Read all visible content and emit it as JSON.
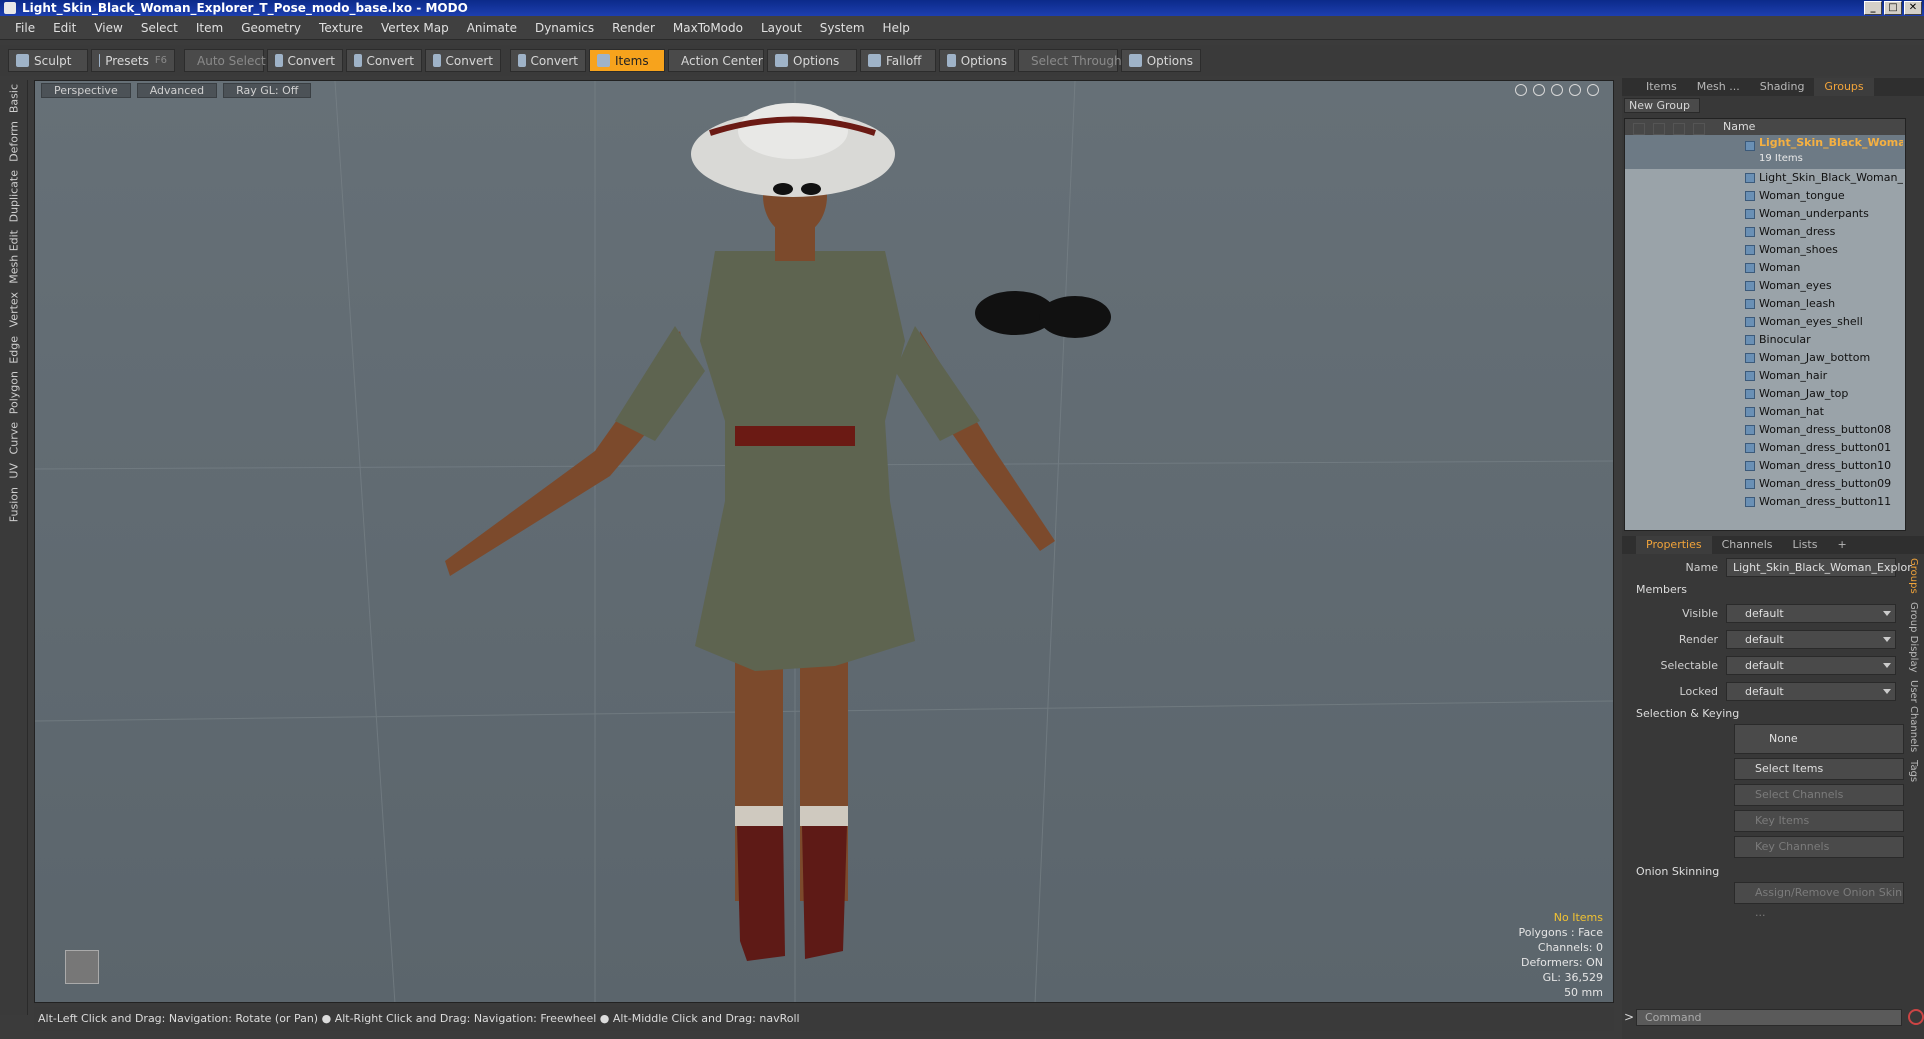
{
  "window": {
    "title": "Light_Skin_Black_Woman_Explorer_T_Pose_modo_base.lxo - MODO",
    "controls": [
      "_",
      "□",
      "✕"
    ]
  },
  "menu": [
    "File",
    "Edit",
    "View",
    "Select",
    "Item",
    "Geometry",
    "Texture",
    "Vertex Map",
    "Animate",
    "Dynamics",
    "Render",
    "MaxToModo",
    "Layout",
    "System",
    "Help"
  ],
  "toolbar": {
    "sculpt": "Sculpt",
    "presets": "Presets",
    "presets_key": "F6",
    "auto_select": "Auto Select",
    "convert1": "Convert",
    "convert2": "Convert",
    "convert3": "Convert",
    "convert4": "Convert",
    "items": "Items",
    "action_center": "Action Center",
    "options1": "Options",
    "falloff": "Falloff",
    "options2": "Options",
    "select_through": "Select Through",
    "options3": "Options"
  },
  "lefttabs": [
    "Basic",
    "Deform",
    "Duplicate",
    "Mesh Edit",
    "Vertex",
    "Edge",
    "Polygon",
    "Curve",
    "UV",
    "Fusion"
  ],
  "viewport": {
    "perspective": "Perspective",
    "advanced": "Advanced",
    "raygl": "Ray GL: Off",
    "info": {
      "no_items": "No Items",
      "polygons": "Polygons : Face",
      "channels": "Channels: 0",
      "deformers": "Deformers: ON",
      "gl": "GL: 36,529",
      "focal": "50 mm"
    }
  },
  "status": "Alt-Left Click and Drag: Navigation: Rotate (or Pan) ● Alt-Right Click and Drag: Navigation: Freewheel ● Alt-Middle Click and Drag: navRoll",
  "panel_tabs": [
    "Items",
    "Mesh ...",
    "Shading",
    "Groups"
  ],
  "new_group": "New Group",
  "tree": {
    "name_header": "Name",
    "group_name": "Light_Skin_Black_Woma ...",
    "group_count": "19 Items",
    "items": [
      "Light_Skin_Black_Woman_ ...",
      "Woman_tongue",
      "Woman_underpants",
      "Woman_dress",
      "Woman_shoes",
      "Woman",
      "Woman_eyes",
      "Woman_leash",
      "Woman_eyes_shell",
      "Binocular",
      "Woman_Jaw_bottom",
      "Woman_hair",
      "Woman_Jaw_top",
      "Woman_hat",
      "Woman_dress_button08",
      "Woman_dress_button01",
      "Woman_dress_button10",
      "Woman_dress_button09",
      "Woman_dress_button11"
    ]
  },
  "prop_tabs": [
    "Properties",
    "Channels",
    "Lists",
    "+"
  ],
  "properties": {
    "name_label": "Name",
    "name_value": "Light_Skin_Black_Woman_Explor",
    "members": "Members",
    "visible_label": "Visible",
    "visible": "default",
    "render_label": "Render",
    "render": "default",
    "selectable_label": "Selectable",
    "selectable": "default",
    "locked_label": "Locked",
    "locked": "default",
    "selection_keying": "Selection & Keying",
    "none": "None",
    "select_items": "Select Items",
    "select_channels": "Select Channels",
    "key_items": "Key Items",
    "key_channels": "Key Channels",
    "onion": "Onion Skinning",
    "assign_onion": "Assign/Remove Onion Skin ..."
  },
  "side_vtabs": [
    "Groups",
    "Group Display",
    "User Channels",
    "Tags"
  ],
  "command": "Command"
}
